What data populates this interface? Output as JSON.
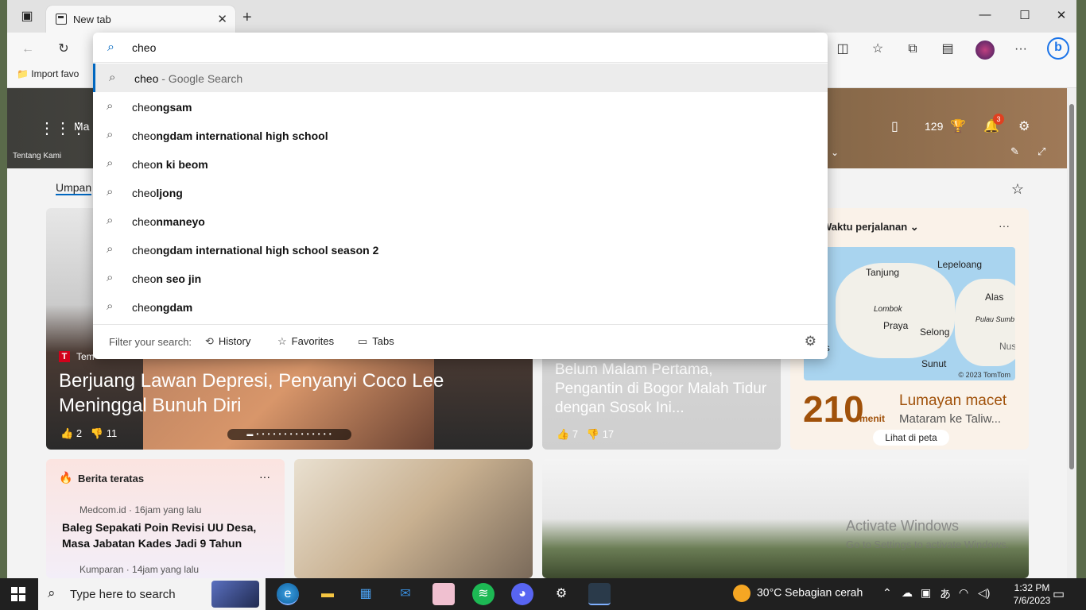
{
  "browser": {
    "tab_title": "New tab",
    "import_favorites": "Import favo",
    "window_controls": [
      "minimize-icon",
      "maximize-icon",
      "close-icon"
    ]
  },
  "newtab": {
    "ms_label": "Ma",
    "about_label": "Tentang Kami",
    "points": "129",
    "notif_count": "3",
    "feed_tab": "Umpan"
  },
  "hero": {
    "source_letter": "T",
    "source": "Tem",
    "title": "Berjuang Lawan Depresi, Penyanyi Coco Lee Meninggal Bunuh Diri",
    "likes": "2",
    "dislikes": "11"
  },
  "mid": {
    "title": "Belum Malam Pertama, Pengantin di Bogor Malah Tidur dengan Sosok Ini...",
    "likes": "7",
    "dislikes": "17"
  },
  "traffic": {
    "header": "Waktu perjalanan",
    "minutes": "210",
    "unit": "menit",
    "status": "Lumayan macet",
    "route": "Mataram ke Taliw...",
    "map_button": "Lihat di peta",
    "map_labels": [
      "Tanjung",
      "Lepeloang",
      "Lombok",
      "Praya",
      "Selong",
      "Alas",
      "Pulau Sumb",
      "Nus",
      "ongas",
      "Sunut"
    ],
    "map_copyright": "© 2023 TomTom"
  },
  "top_news": {
    "header": "Berita teratas",
    "source1": "Medcom.id · 16jam yang lalu",
    "title1": "Baleg Sepakati Poin Revisi UU Desa, Masa Jabatan Kades Jadi 9 Tahun",
    "source2": "Kumparan · 14jam yang lalu"
  },
  "activate": {
    "line1": "Activate Windows",
    "line2": "Go to Settings to activate Windows."
  },
  "omnibox": {
    "query": "cheo",
    "suggestions": [
      {
        "prefix": "cheo",
        "bold": "",
        "suffix": " - Google Search",
        "selected": true
      },
      {
        "prefix": "cheo",
        "bold": "ngsam",
        "suffix": "",
        "selected": false
      },
      {
        "prefix": "cheo",
        "bold": "ngdam international high school",
        "suffix": "",
        "selected": false
      },
      {
        "prefix": "cheo",
        "bold": "n ki beom",
        "suffix": "",
        "selected": false
      },
      {
        "prefix": "cheo",
        "bold": "ljong",
        "suffix": "",
        "selected": false
      },
      {
        "prefix": "cheo",
        "bold": "nmaneyo",
        "suffix": "",
        "selected": false
      },
      {
        "prefix": "cheo",
        "bold": "ngdam international high school season 2",
        "suffix": "",
        "selected": false
      },
      {
        "prefix": "cheo",
        "bold": "n seo jin",
        "suffix": "",
        "selected": false
      },
      {
        "prefix": "cheo",
        "bold": "ngdam",
        "suffix": "",
        "selected": false
      }
    ],
    "filter_label": "Filter your search:",
    "filters": [
      "History",
      "Favorites",
      "Tabs"
    ]
  },
  "taskbar": {
    "search_placeholder": "Type here to search",
    "weather": "30°C  Sebagian cerah",
    "time": "1:32 PM",
    "date": "7/6/2023",
    "apps": [
      "edge-icon",
      "file-explorer-icon",
      "store-icon",
      "mail-icon",
      "game-icon",
      "spotify-icon",
      "discord-icon",
      "settings-icon",
      "app-icon"
    ]
  }
}
